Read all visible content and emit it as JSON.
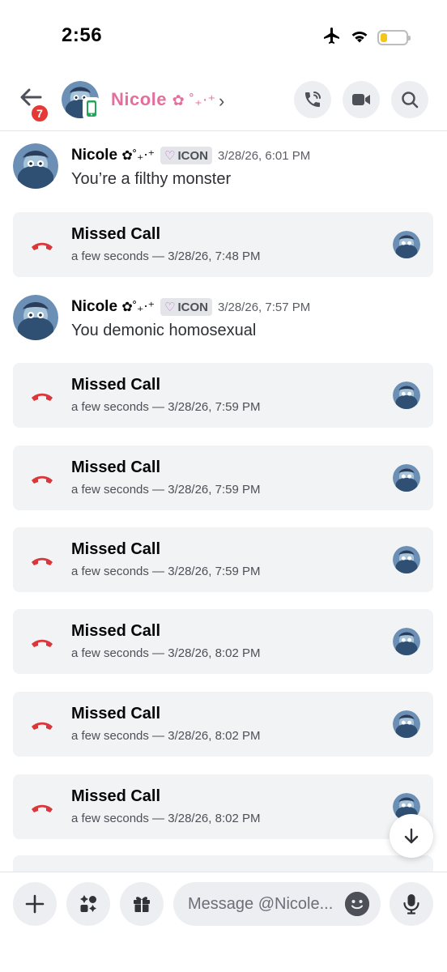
{
  "status_bar": {
    "time": "2:56",
    "icons": [
      "airplane-icon",
      "wifi-icon",
      "battery-icon"
    ],
    "battery_level": 0.25,
    "battery_color": "#f5c518"
  },
  "header": {
    "back_icon": "arrow-left-icon",
    "unread_badge": "7",
    "name": "Nicole",
    "name_decoration": "✿ ˚₊‧⁺",
    "name_color": "#e46f9d",
    "chevron": "›",
    "actions": [
      "phone-call-icon",
      "video-camera-icon",
      "search-icon"
    ]
  },
  "messages": [
    {
      "type": "text",
      "author": "Nicole",
      "author_decoration": "✿˚₊‧⁺",
      "tag": "ICON",
      "timestamp": "3/28/26, 6:01 PM",
      "text": "You’re a filthy monster"
    },
    {
      "type": "call",
      "title": "Missed Call",
      "subtitle": "a few seconds — 3/28/26, 7:48 PM"
    },
    {
      "type": "text",
      "author": "Nicole",
      "author_decoration": "✿˚₊‧⁺",
      "tag": "ICON",
      "timestamp": "3/28/26, 7:57 PM",
      "text": "You demonic homosexual"
    },
    {
      "type": "call",
      "title": "Missed Call",
      "subtitle": "a few seconds — 3/28/26, 7:59 PM"
    },
    {
      "type": "call",
      "title": "Missed Call",
      "subtitle": "a few seconds — 3/28/26, 7:59 PM"
    },
    {
      "type": "call",
      "title": "Missed Call",
      "subtitle": "a few seconds — 3/28/26, 7:59 PM"
    },
    {
      "type": "call",
      "title": "Missed Call",
      "subtitle": "a few seconds — 3/28/26, 8:02 PM"
    },
    {
      "type": "call",
      "title": "Missed Call",
      "subtitle": "a few seconds — 3/28/26, 8:02 PM"
    },
    {
      "type": "call",
      "title": "Missed Call",
      "subtitle": "a few seconds — 3/28/26, 8:02 PM"
    }
  ],
  "colors": {
    "missed_call_red": "#da373c",
    "card_bg": "#f2f3f5"
  },
  "composer": {
    "placeholder": "Message @Nicole...",
    "value": "",
    "buttons": [
      "plus-icon",
      "apps-icon",
      "gift-icon",
      "emoji-icon",
      "microphone-icon"
    ]
  },
  "scroll_button_icon": "arrow-down-icon"
}
